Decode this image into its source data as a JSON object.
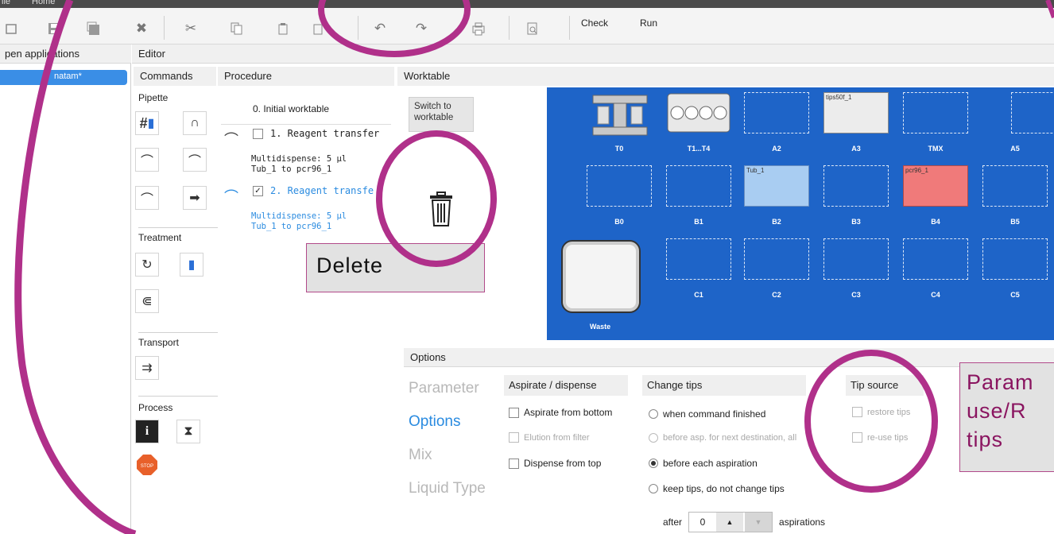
{
  "menu": {
    "file": "ile",
    "home": "Home"
  },
  "toolbar": {
    "check_label": "Check",
    "run_label": "Run"
  },
  "left_panel": {
    "header": "pen applications",
    "open_item": "natam*"
  },
  "editor": {
    "header": "Editor"
  },
  "columns": {
    "commands": "Commands",
    "procedure": "Procedure",
    "worktable": "Worktable"
  },
  "commands": {
    "pipette": "Pipette",
    "treatment": "Treatment",
    "transport": "Transport",
    "process": "Process",
    "stop_label": "STOP"
  },
  "procedure": {
    "initial": "0. Initial worktable",
    "step1": {
      "title": "1. Reagent transfer",
      "line1": "Multidispense: 5 µl",
      "line2": "Tub_1 to pcr96_1"
    },
    "step2": {
      "title": "2. Reagent transfe",
      "line1": "Multidispense: 5 µl",
      "line2": "Tub_1 to pcr96_1"
    }
  },
  "switch_button": {
    "line1": "Switch to",
    "line2": "worktable"
  },
  "worktable": {
    "slots": [
      "T0",
      "T1...T4",
      "A2",
      "A3",
      "TMX",
      "A5",
      "B0",
      "B1",
      "B2",
      "B3",
      "B4",
      "B5",
      "C1",
      "C2",
      "C3",
      "C4",
      "C5"
    ],
    "waste_label": "Waste",
    "a3_label": "tips50f_1",
    "b2_label": "Tub_1",
    "b4_label": "pcr96_1"
  },
  "options": {
    "header": "Options",
    "nav": [
      "Parameter",
      "Options",
      "Mix",
      "Liquid Type"
    ],
    "active_nav": "Options",
    "aspirate_group": {
      "title": "Aspirate / dispense",
      "items": [
        "Aspirate from bottom",
        "Elution from filter",
        "Dispense from top"
      ]
    },
    "change_tips_group": {
      "title": "Change tips",
      "items": [
        "when command finished",
        "before asp. for next destination, all",
        "before each aspiration",
        "keep tips, do not change tips"
      ],
      "selected": "before each aspiration"
    },
    "tip_source_group": {
      "title": "Tip source",
      "items": [
        "restore tips",
        "re-use tips"
      ]
    },
    "after": {
      "prefix": "after",
      "value": "0",
      "suffix": "aspirations"
    }
  },
  "annotations": {
    "delete": "Delete",
    "param_line1": "Param",
    "param_line2": "use/R",
    "param_line3": "tips"
  },
  "colors": {
    "worktable_blue": "#1e64c8",
    "accent_blue": "#2a8be0",
    "annotation_magenta": "#b0308a",
    "plate_red": "#f07a7a",
    "tube_blue": "#a9cdf2"
  }
}
